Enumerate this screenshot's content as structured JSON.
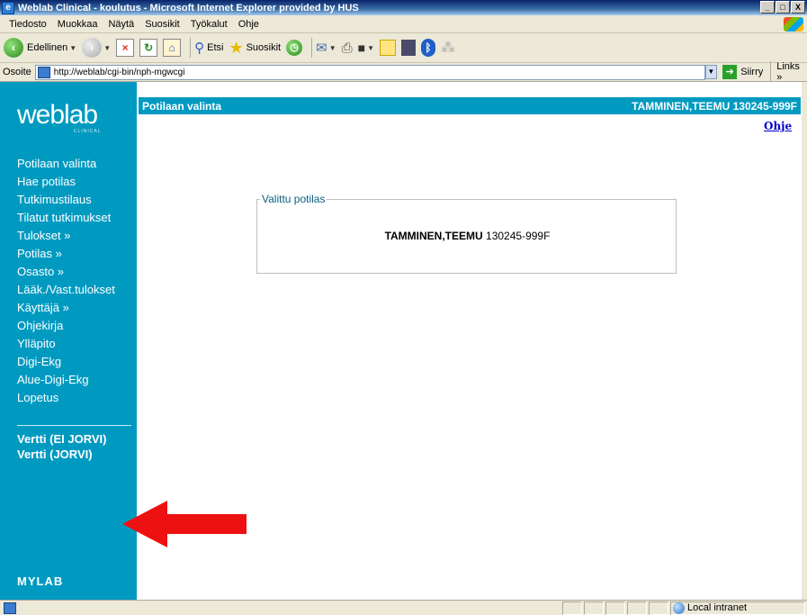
{
  "window": {
    "title": "Weblab Clinical - koulutus - Microsoft Internet Explorer provided by HUS",
    "buttons": [
      "_",
      "□",
      "X"
    ]
  },
  "menu": [
    "Tiedosto",
    "Muokkaa",
    "Näytä",
    "Suosikit",
    "Työkalut",
    "Ohje"
  ],
  "toolbar": {
    "back_label": "Edellinen",
    "search_label": "Etsi",
    "favorites_label": "Suosikit"
  },
  "address": {
    "label": "Osoite",
    "url": "http://weblab/cgi-bin/nph-mgwcgi",
    "go_label": "Siirry",
    "links_label": "Links »"
  },
  "sidebar": {
    "logo": "weblab",
    "logo_sub": "CLINICAL",
    "items": [
      "Potilaan valinta",
      "Hae potilas",
      "Tutkimustilaus",
      "Tilatut tutkimukset",
      "Tulokset »",
      "Potilas »",
      "Osasto »",
      "Lääk./Vast.tulokset",
      "Käyttäjä »",
      "Ohjekirja",
      "Ylläpito",
      "Digi-Ekg",
      "Alue-Digi-Ekg",
      "Lopetus"
    ],
    "extra_links": [
      "Vertti (EI JORVI)",
      "Vertti (JORVI)"
    ],
    "footer_logo": "MYLAB"
  },
  "header": {
    "title": "Potilaan valinta",
    "patient": "TAMMINEN,TEEMU 130245-999F",
    "help_link": "Ohje"
  },
  "selected_patient": {
    "legend": "Valittu potilas",
    "name": "TAMMINEN,TEEMU",
    "id": "130245-999F"
  },
  "status": {
    "zone": "Local intranet"
  }
}
